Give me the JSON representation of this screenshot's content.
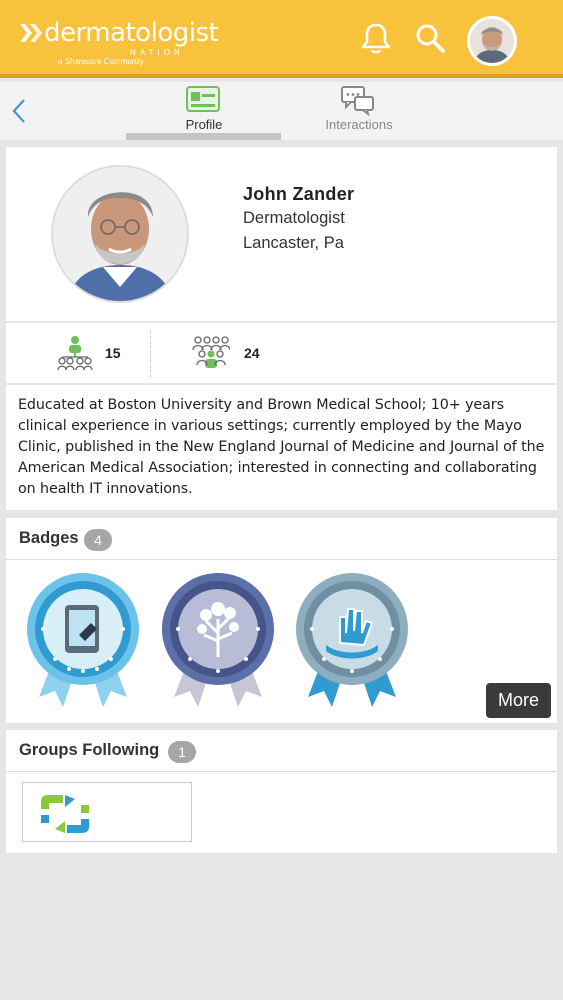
{
  "header": {
    "brand_name": "dermatologist",
    "brand_suffix": "NATION",
    "brand_tagline": "a Sharecare Community",
    "icons": [
      "bell-icon",
      "search-icon",
      "avatar"
    ],
    "accent_color": "#f9c23c"
  },
  "tabs": [
    {
      "label": "Profile",
      "active": true
    },
    {
      "label": "Interactions",
      "active": false
    }
  ],
  "profile": {
    "name": "John Zander",
    "specialty": "Dermatologist",
    "location": "Lancaster, Pa"
  },
  "stats": [
    {
      "icon": "network-icon",
      "value": "15"
    },
    {
      "icon": "group-icon",
      "value": "24"
    }
  ],
  "bio": "Educated at Boston University and Brown Medical School; 10+ years clinical experience in various settings; currently employed by the Mayo Clinic, published in the New England Journal of Medicine and Journal of the American Medical Association; interested in connecting and collaborating on health IT innovations.",
  "badges": {
    "title": "Badges",
    "count": "4",
    "items": [
      "tablet-badge",
      "tree-badge",
      "hand-badge"
    ],
    "more_label": "More"
  },
  "groups": {
    "title": "Groups Following",
    "count": "1"
  }
}
